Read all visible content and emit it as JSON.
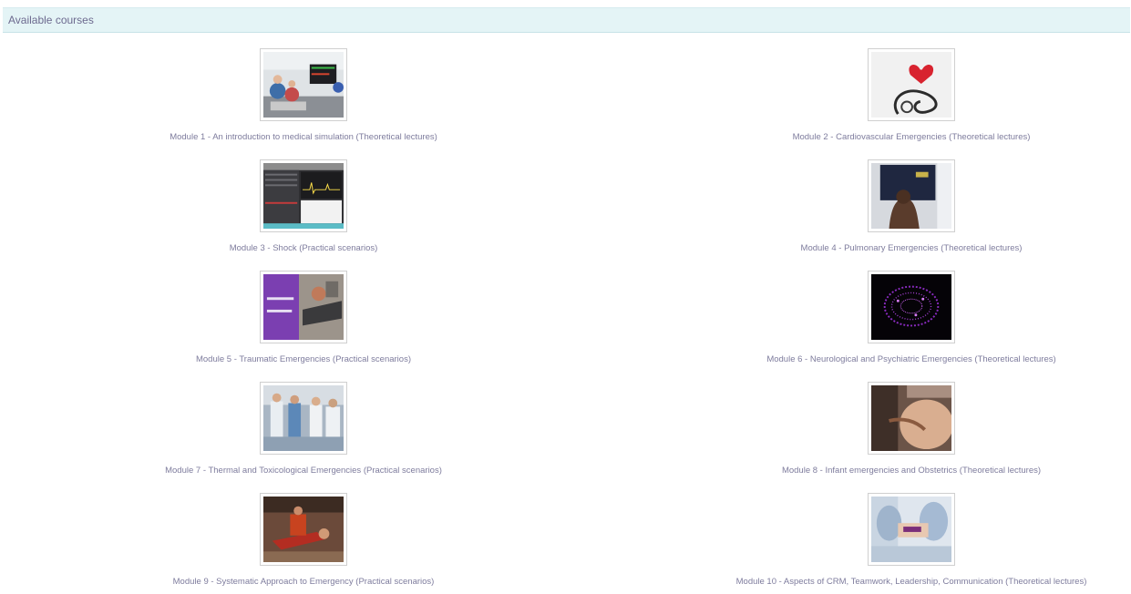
{
  "header": {
    "title": "Available courses"
  },
  "courses": [
    {
      "title": "Module 1 - An introduction to medical simulation (Theoretical lectures)",
      "image": "simulation-room-image"
    },
    {
      "title": "Module 2 - Cardiovascular Emergencies (Theoretical lectures)",
      "image": "heart-stethoscope-image"
    },
    {
      "title": "Module 3 - Shock (Practical scenarios)",
      "image": "monitor-software-image"
    },
    {
      "title": "Module 4 - Pulmonary Emergencies (Theoretical lectures)",
      "image": "lung-xray-viewing-image"
    },
    {
      "title": "Module 5 - Traumatic Emergencies (Practical scenarios)",
      "image": "trauma-banner-image"
    },
    {
      "title": "Module 6 - Neurological and Psychiatric Emergencies (Theoretical lectures)",
      "image": "brain-network-image"
    },
    {
      "title": "Module 7 - Thermal and Toxicological Emergencies (Practical scenarios)",
      "image": "medical-team-image"
    },
    {
      "title": "Module 8 - Infant emergencies and Obstetrics (Theoretical lectures)",
      "image": "pregnancy-exam-image"
    },
    {
      "title": "Module 9 - Systematic Approach to Emergency (Practical scenarios)",
      "image": "accident-victim-image"
    },
    {
      "title": "Module 10 - Aspects of CRM, Teamwork, Leadership, Communication (Theoretical lectures)",
      "image": "team-hands-image"
    }
  ]
}
